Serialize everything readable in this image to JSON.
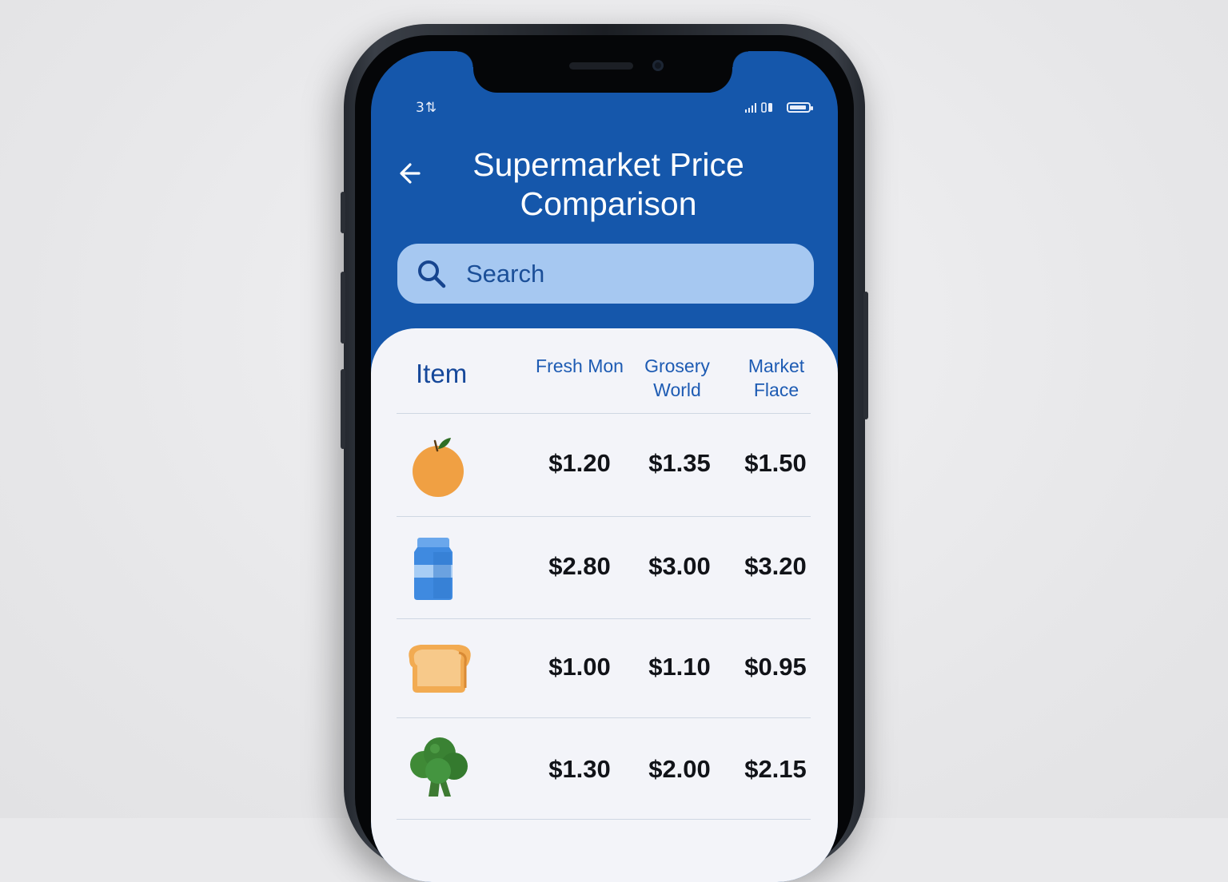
{
  "status_bar": {
    "time": "3⇅"
  },
  "header": {
    "title": "Supermarket Price Comparison",
    "back_icon": "arrow-left-icon"
  },
  "search": {
    "placeholder": "Search",
    "value": "",
    "icon": "search-icon"
  },
  "table": {
    "columns": [
      "Item",
      "Fresh Mon",
      "Grosery World",
      "Market Flace"
    ],
    "rows": [
      {
        "icon": "orange-icon",
        "prices": [
          "$1.20",
          "$1.35",
          "$1.50"
        ]
      },
      {
        "icon": "milk-carton-icon",
        "prices": [
          "$2.80",
          "$3.00",
          "$3.20"
        ]
      },
      {
        "icon": "bread-icon",
        "prices": [
          "$1.00",
          "$1.10",
          "$0.95"
        ]
      },
      {
        "icon": "broccoli-icon",
        "prices": [
          "$1.30",
          "$2.00",
          "$2.15"
        ]
      }
    ]
  },
  "colors": {
    "header_blue": "#1557ab",
    "search_fill": "#a6c8f1",
    "card_bg": "#f3f4f9",
    "price_text": "#111318"
  }
}
